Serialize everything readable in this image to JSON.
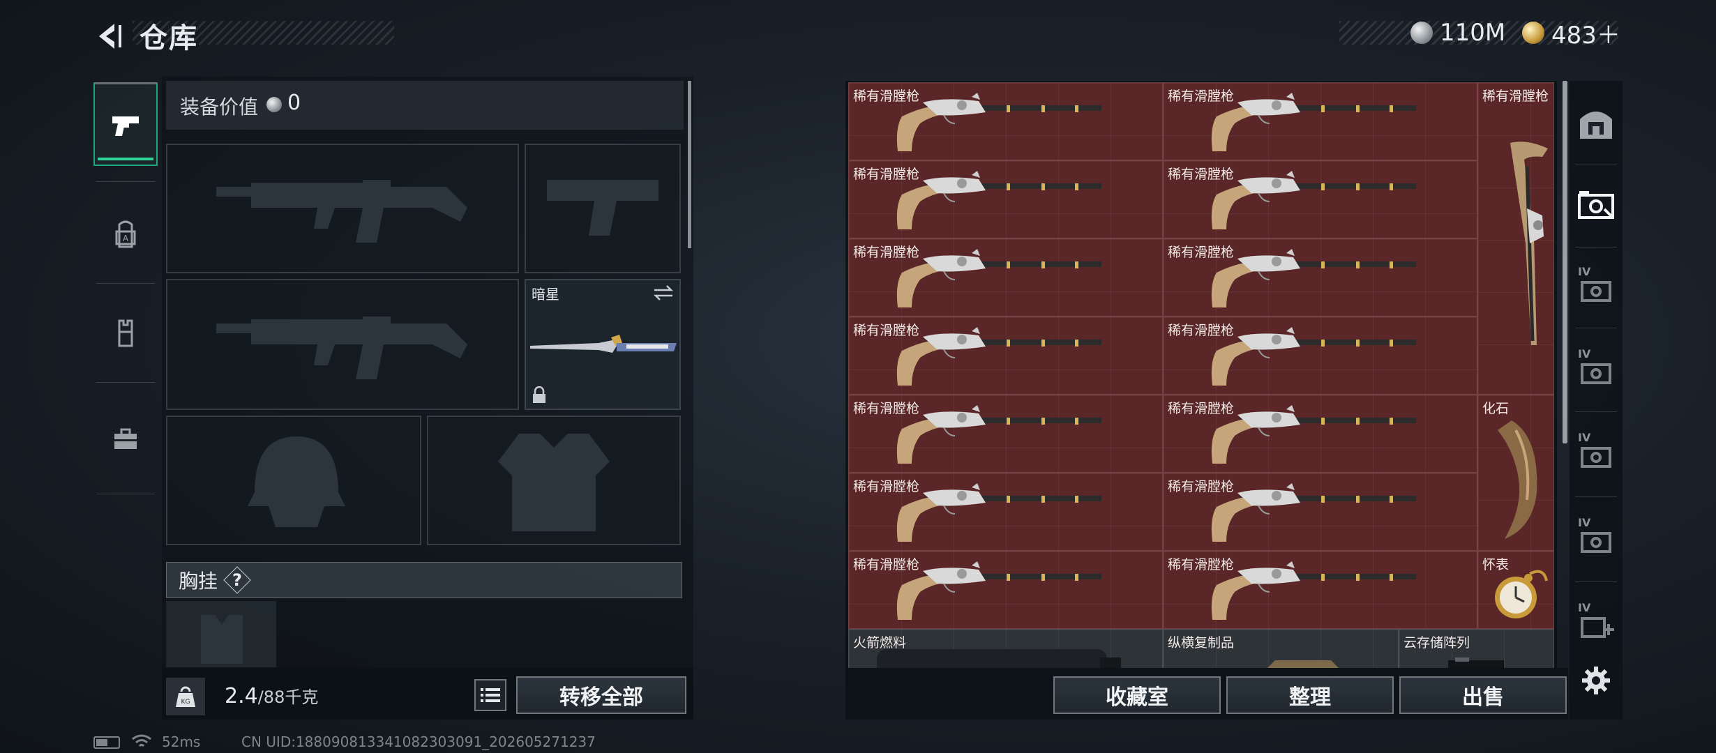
{
  "header": {
    "title": "仓库"
  },
  "currency": {
    "silver": "110M",
    "gold": "483＋"
  },
  "left_tabs": [
    "pistol-icon",
    "backpack-icon",
    "vest-icon",
    "toolbox-icon"
  ],
  "equipment": {
    "value_label": "装备价值",
    "value": "0",
    "melee_slot": {
      "label": "暗星"
    },
    "chest_label": "胸挂",
    "chest_help": "?"
  },
  "weight": {
    "current": "2.4",
    "max": "/88千克"
  },
  "buttons": {
    "transfer_all": "转移全部",
    "collection": "收藏室",
    "organize": "整理",
    "sell": "出售"
  },
  "storage": {
    "musket_label": "稀有滑膛枪",
    "fossil_label": "化石",
    "watch_label": "怀表",
    "bottom_labels": [
      "火箭燃料",
      "纵横复制品",
      "云存储阵列"
    ]
  },
  "status_bar": {
    "ping": "52ms",
    "uid": "CN UID:1880908133410823030​91_202605271237"
  }
}
